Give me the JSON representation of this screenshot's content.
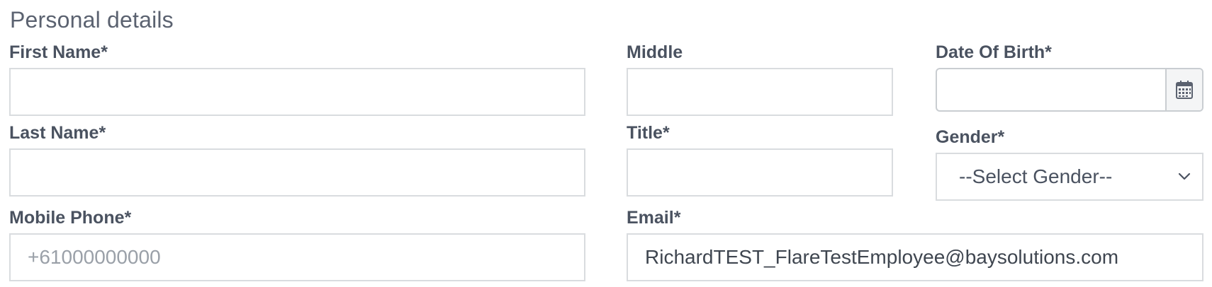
{
  "section": {
    "title": "Personal details"
  },
  "fields": {
    "first_name": {
      "label": "First Name*",
      "value": ""
    },
    "middle": {
      "label": "Middle",
      "value": ""
    },
    "dob": {
      "label": "Date Of Birth*",
      "value": "",
      "icon": "calendar-icon"
    },
    "last_name": {
      "label": "Last Name*",
      "value": ""
    },
    "title": {
      "label": "Title*",
      "value": ""
    },
    "gender": {
      "label": "Gender*",
      "selected": "--Select Gender--",
      "icon": "chevron-down-icon"
    },
    "mobile": {
      "label": "Mobile Phone*",
      "value": "",
      "placeholder": "+61000000000"
    },
    "email": {
      "label": "Email*",
      "value": "RichardTEST_FlareTestEmployee@baysolutions.com"
    }
  }
}
